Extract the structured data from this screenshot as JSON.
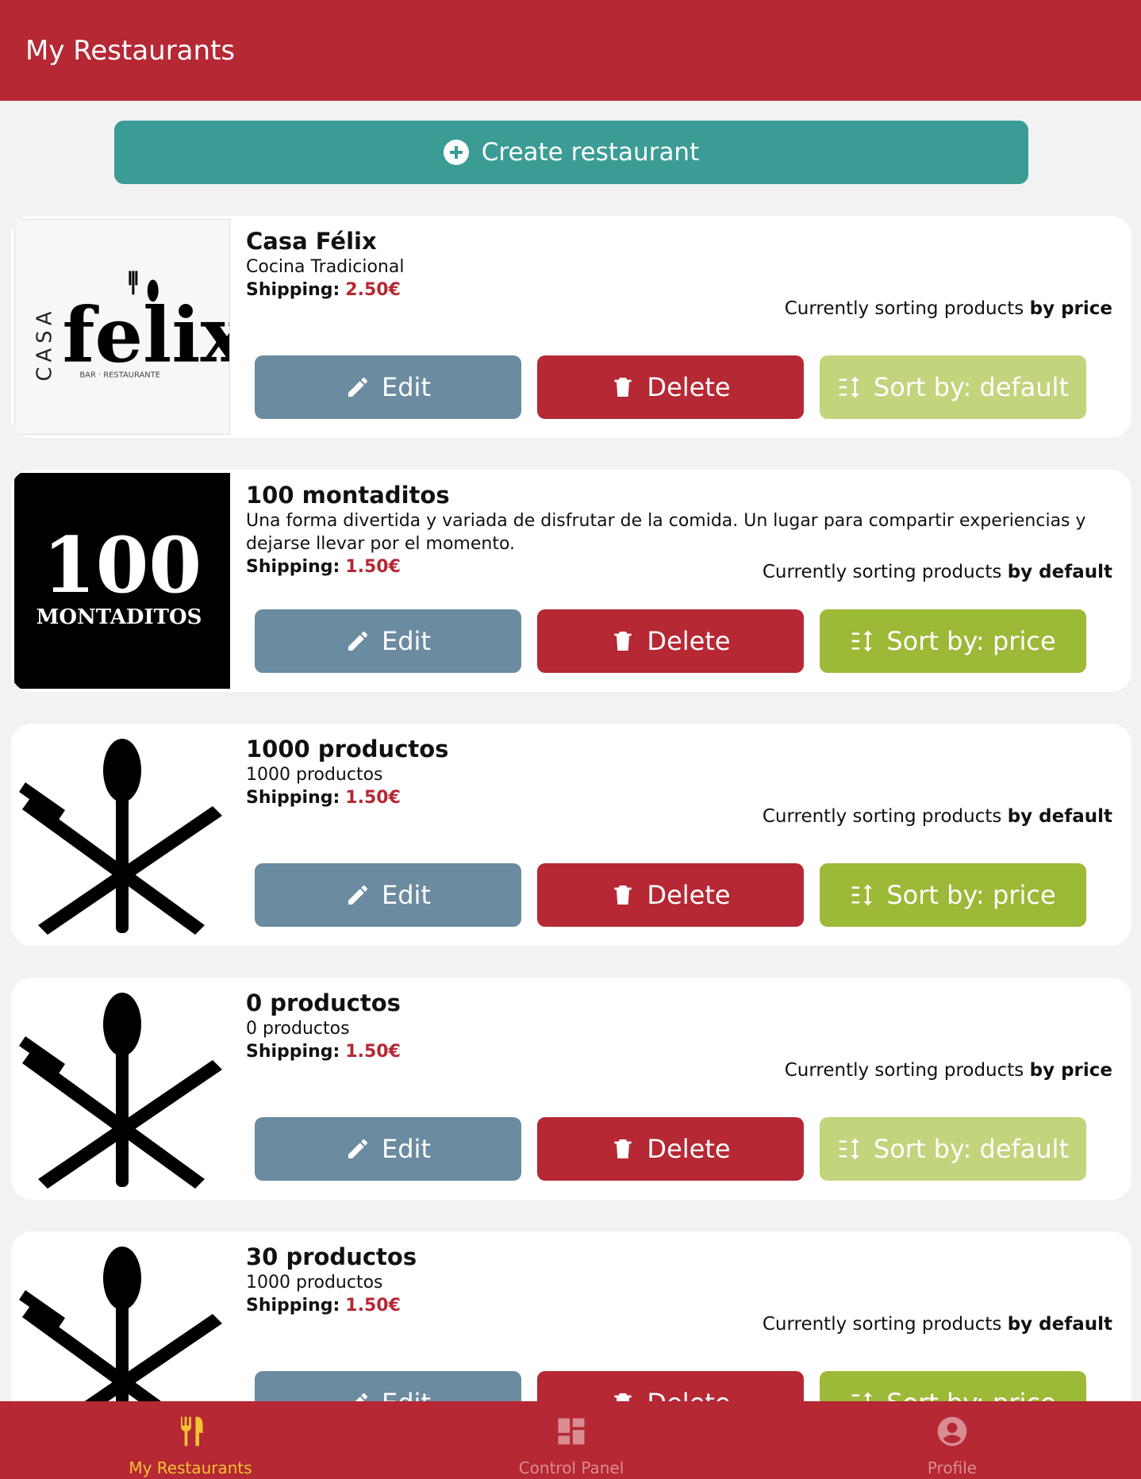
{
  "header": {
    "title": "My Restaurants"
  },
  "create_button": {
    "label": "Create restaurant",
    "icon": "plus-circle-icon"
  },
  "actions": {
    "edit": "Edit",
    "delete": "Delete"
  },
  "restaurants": [
    {
      "name": "Casa Félix",
      "description": "Cocina Tradicional",
      "shipping_label": "Shipping:",
      "shipping_value": "2.50€",
      "sort_note_prefix": "Currently sorting products ",
      "sort_note_value": "by price",
      "sort_button": "Sort by: default",
      "logo_text_top": "CASA",
      "logo_text_main": "felix",
      "logo_text_sub": "BAR · RESTAURANTE"
    },
    {
      "name": "100 montaditos",
      "description": "Una forma divertida y variada de disfrutar de la comida. Un lugar para compartir experiencias y dejarse llevar por el momento.",
      "shipping_label": "Shipping:",
      "shipping_value": "1.50€",
      "sort_note_prefix": "Currently sorting products ",
      "sort_note_value": "by default",
      "sort_button": "Sort by: price",
      "logo_text_top": "100",
      "logo_text_main": "MONTADITOS"
    },
    {
      "name": "1000 productos",
      "description": "1000 productos",
      "shipping_label": "Shipping:",
      "shipping_value": "1.50€",
      "sort_note_prefix": "Currently sorting products ",
      "sort_note_value": "by default",
      "sort_button": "Sort by: price"
    },
    {
      "name": "0 productos",
      "description": "0 productos",
      "shipping_label": "Shipping:",
      "shipping_value": "1.50€",
      "sort_note_prefix": "Currently sorting products ",
      "sort_note_value": "by price",
      "sort_button": "Sort by: default"
    },
    {
      "name": "30 productos",
      "description": "1000 productos",
      "shipping_label": "Shipping:",
      "shipping_value": "1.50€",
      "sort_note_prefix": "Currently sorting products ",
      "sort_note_value": "by default",
      "sort_button": "Sort by: price"
    }
  ],
  "tabs": [
    {
      "label": "My Restaurants",
      "icon": "fork-knife-icon",
      "active": true
    },
    {
      "label": "Control Panel",
      "icon": "dashboard-icon",
      "active": false
    },
    {
      "label": "Profile",
      "icon": "user-circle-icon",
      "active": false
    }
  ],
  "colors": {
    "primary": "#b52834",
    "teal": "#3b9c96",
    "edit": "#6a8ba0",
    "sort_dark": "#9cb937",
    "sort_light": "#c2d47c",
    "tab_active": "#f2c332"
  }
}
